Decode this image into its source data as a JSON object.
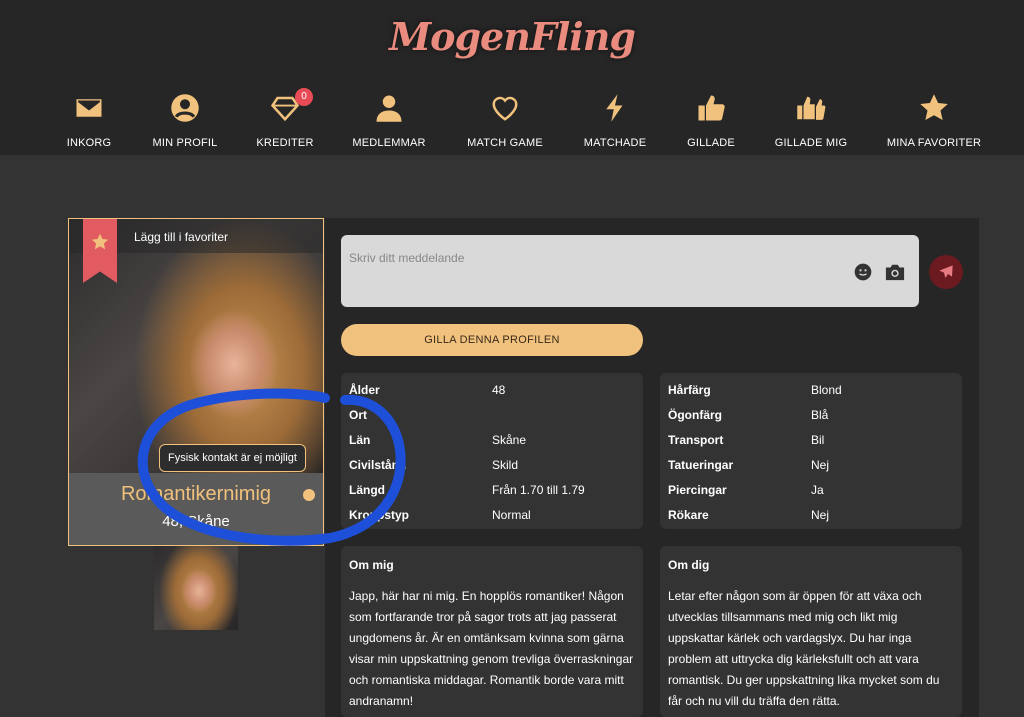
{
  "logo": "MogenFling",
  "nav": [
    {
      "label": "INKORG",
      "icon": "envelope-icon"
    },
    {
      "label": "MIN PROFIL",
      "icon": "user-circle-icon"
    },
    {
      "label": "KREDITER",
      "icon": "diamond-icon",
      "badge": "0"
    },
    {
      "label": "MEDLEMMAR",
      "icon": "user-icon"
    },
    {
      "label": "MATCH GAME",
      "icon": "heart-outline-icon"
    },
    {
      "label": "MATCHADE",
      "icon": "lightning-icon"
    },
    {
      "label": "GILLADE",
      "icon": "thumbs-up-icon"
    },
    {
      "label": "GILLADE MIG",
      "icon": "double-thumbs-up-icon"
    },
    {
      "label": "MINA FAVORITER",
      "icon": "star-icon"
    }
  ],
  "profile": {
    "favorite_label": "Lägg till i favoriter",
    "tooltip": "Fysisk kontakt är ej möjligt",
    "name": "Romantikernimig",
    "subtitle": "48, Skåne"
  },
  "message": {
    "placeholder": "Skriv ditt meddelande"
  },
  "like_button": "GILLA DENNA PROFILEN",
  "details_left": [
    {
      "key": "Ålder",
      "value": "48"
    },
    {
      "key": "Ort",
      "value": ""
    },
    {
      "key": "Län",
      "value": "Skåne"
    },
    {
      "key": "Civilstånd",
      "value": "Skild"
    },
    {
      "key": "Längd",
      "value": "Från 1.70 till 1.79"
    },
    {
      "key": "Kroppstyp",
      "value": "Normal"
    }
  ],
  "details_right": [
    {
      "key": "Hårfärg",
      "value": "Blond"
    },
    {
      "key": "Ögonfärg",
      "value": "Blå"
    },
    {
      "key": "Transport",
      "value": "Bil"
    },
    {
      "key": "Tatueringar",
      "value": "Nej"
    },
    {
      "key": "Piercingar",
      "value": "Ja"
    },
    {
      "key": "Rökare",
      "value": "Nej"
    }
  ],
  "about_me": {
    "title": "Om mig",
    "body": "Japp, här har ni mig. En hopplös romantiker! Någon som fortfarande tror på sagor trots att jag passerat ungdomens år. Är en omtänksam kvinna som gärna visar min uppskattning genom trevliga överraskningar och romantiska middagar. Romantik borde vara mitt andranamn!"
  },
  "about_you": {
    "title": "Om dig",
    "body": "Letar efter någon som är öppen för att växa och utvecklas tillsammans med mig och likt mig uppskattar kärlek och vardagslyx. Du har inga problem att uttrycka dig kärleksfullt och att vara romantisk. Du ger uppskattning lika mycket som du får och nu vill du träffa den rätta."
  },
  "colors": {
    "accent": "#f1c27d",
    "ribbon": "#e25b61",
    "annotation": "#1e4fd8"
  }
}
